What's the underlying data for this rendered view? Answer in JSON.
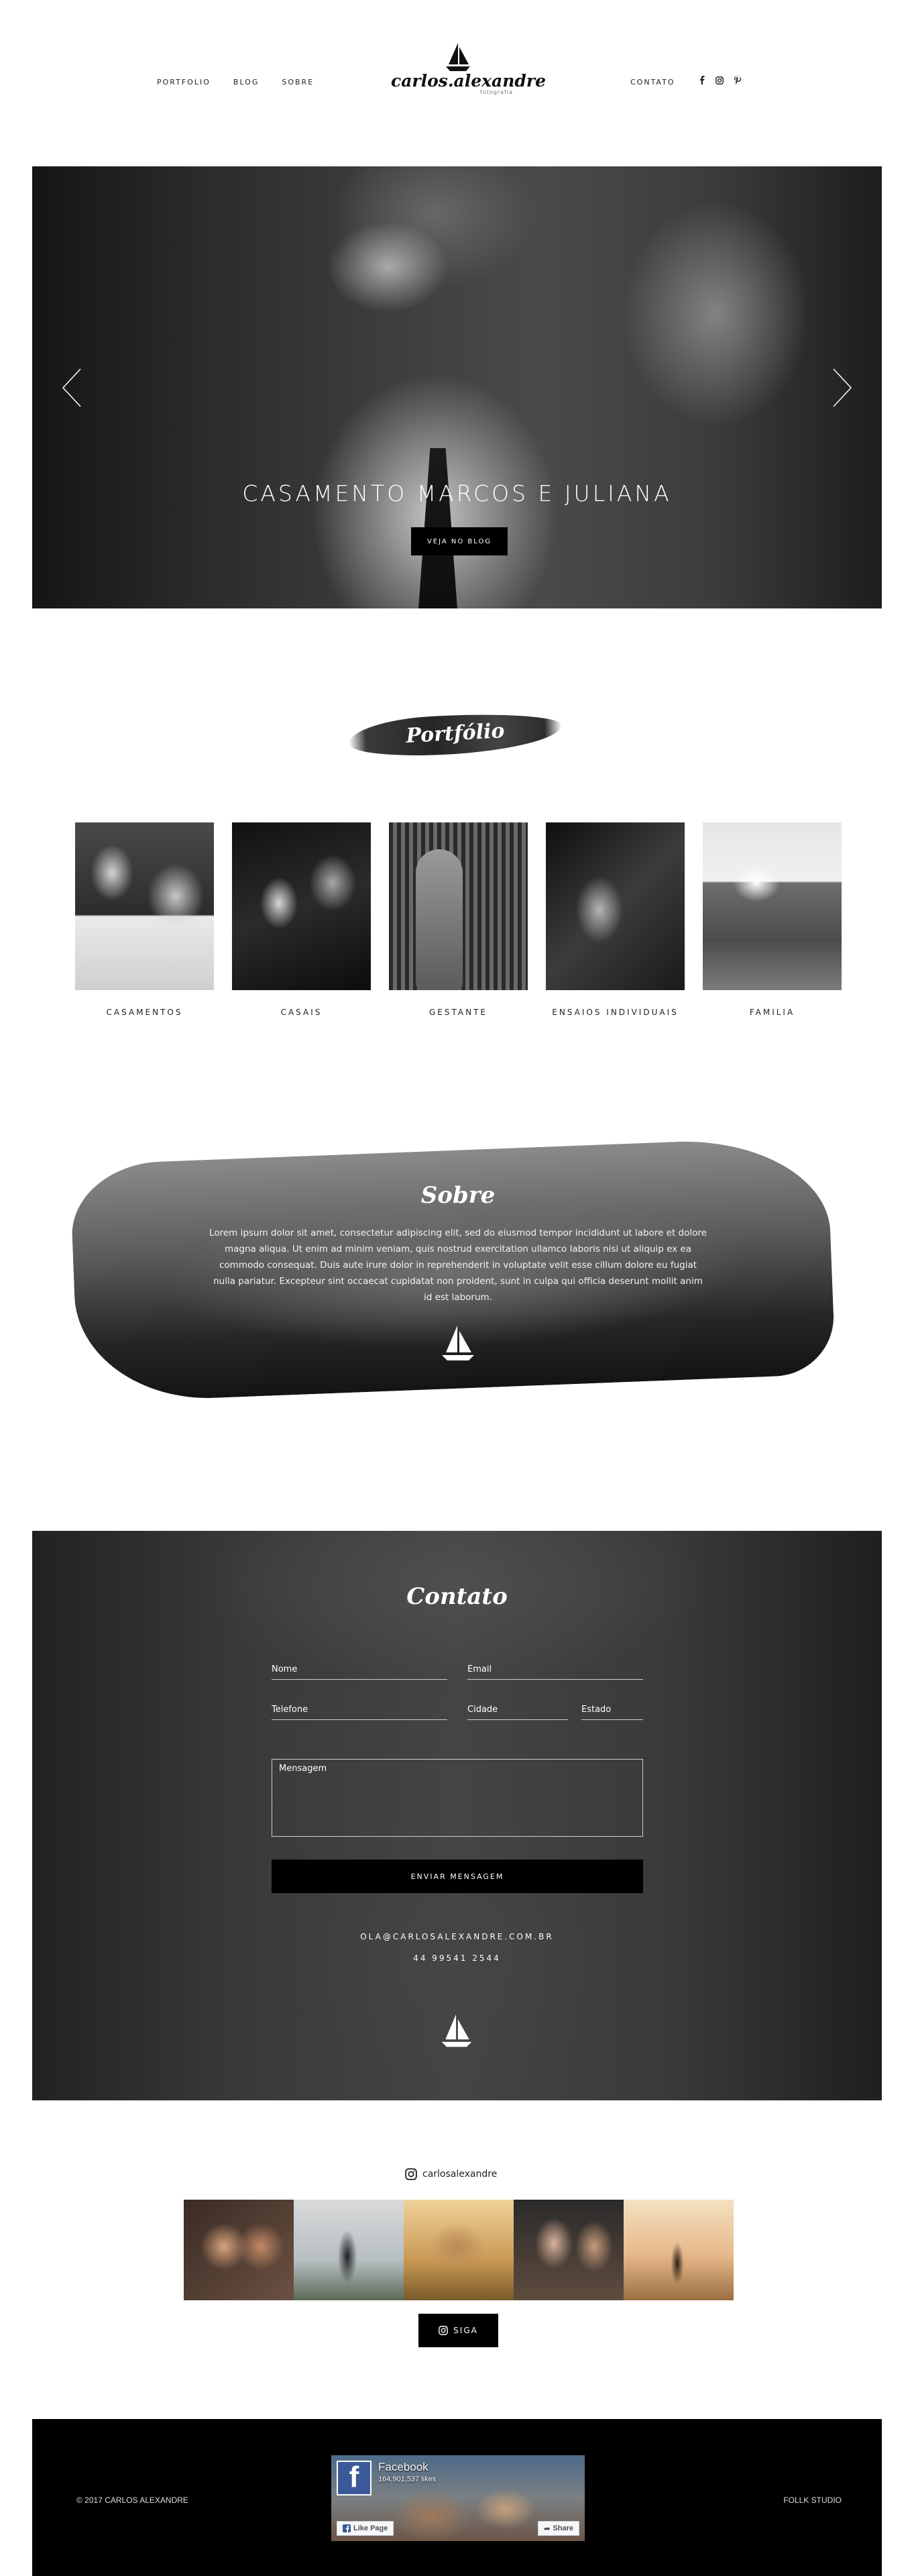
{
  "header": {
    "nav_left": [
      "PORTFOLIO",
      "BLOG",
      "SOBRE"
    ],
    "logo_name": "carlos.alexandre",
    "logo_sub": "fotografia",
    "nav_contact": "CONTATO",
    "social_icons": [
      "facebook-icon",
      "instagram-icon",
      "pinterest-icon"
    ]
  },
  "hero": {
    "title": "CASAMENTO MARCOS E JULIANA",
    "button": "VEJA NO BLOG"
  },
  "portfolio": {
    "title": "Portfólio",
    "categories": [
      "CASAMENTOS",
      "CASAIS",
      "GESTANTE",
      "ENSAIOS INDIVIDUAIS",
      "FAMILIA"
    ]
  },
  "sobre": {
    "title": "Sobre",
    "text": "Lorem ipsum dolor sit amet, consectetur adipiscing elit, sed do eiusmod tempor incididunt ut labore et dolore magna aliqua. Ut enim ad minim veniam, quis nostrud exercitation ullamco laboris nisi ut aliquip ex ea commodo consequat. Duis aute irure dolor in reprehenderit in voluptate velit esse cillum dolore eu fugiat nulla pariatur. Excepteur sint occaecat cupidatat non proident, sunt in culpa qui officia deserunt mollit anim id est laborum."
  },
  "contato": {
    "title": "Contato",
    "fields": {
      "nome": "Nome",
      "email": "Email",
      "telefone": "Telefone",
      "cidade": "Cidade",
      "estado": "Estado",
      "mensagem": "Mensagem"
    },
    "send_button": "ENVIAR MENSAGEM",
    "email": "OLA@CARLOSALEXANDRE.COM.BR",
    "phone": "44 99541 2544"
  },
  "instagram": {
    "handle": "carlosalexandre",
    "follow_button": "SIGA"
  },
  "footer": {
    "copyright": "© 2017 CARLOS ALEXANDRE",
    "credit": "FOLLK STUDIO",
    "facebook": {
      "name": "Facebook",
      "likes": "164,901,537 likes",
      "like_button": "Like Page",
      "share_button": "Share"
    }
  },
  "colors": {
    "accent": "#000000",
    "background": "#ffffff",
    "facebook_blue": "#3b5998"
  }
}
